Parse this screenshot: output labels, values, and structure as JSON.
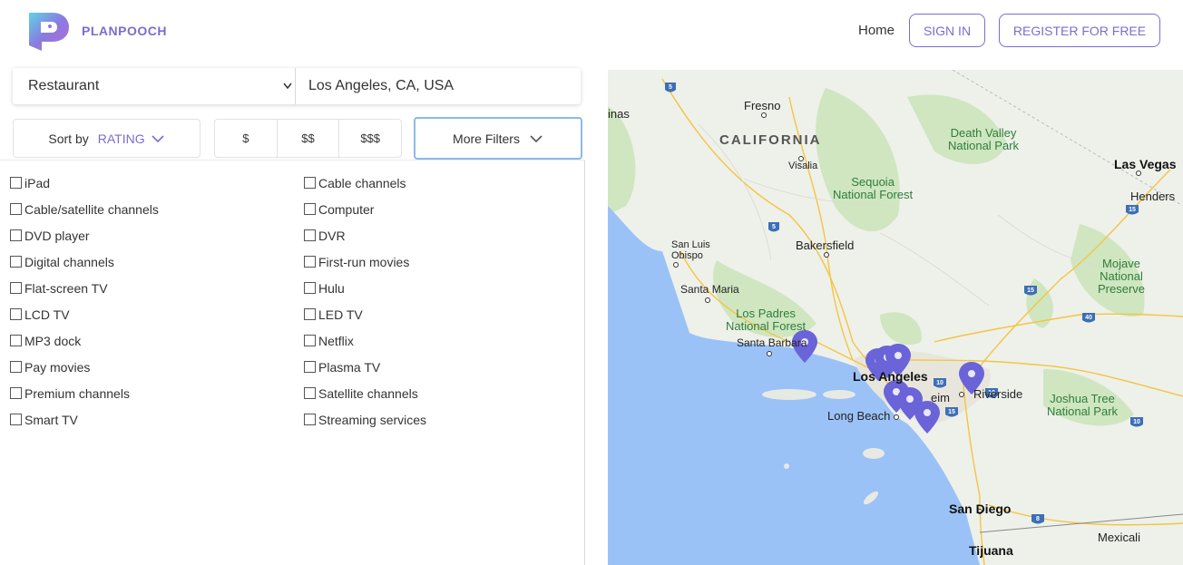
{
  "header": {
    "brand": "PLANPOOCH",
    "nav_home": "Home",
    "sign_in": "SIGN IN",
    "register": "REGISTER FOR FREE"
  },
  "search": {
    "category": "Restaurant",
    "location": "Los Angeles, CA, USA"
  },
  "filters_bar": {
    "sort_label": "Sort by",
    "sort_value": "RATING",
    "price_options": [
      "$",
      "$$",
      "$$$"
    ],
    "more_filters": "More Filters"
  },
  "amenities": {
    "left": [
      "iPad",
      "Cable/satellite channels",
      "DVD player",
      "Digital channels",
      "Flat-screen TV",
      "LCD TV",
      "MP3 dock",
      "Pay movies",
      "Premium channels",
      "Smart TV"
    ],
    "right": [
      "Cable channels",
      "Computer",
      "DVR",
      "First-run movies",
      "Hulu",
      "LED TV",
      "Netflix",
      "Plasma TV",
      "Satellite channels",
      "Streaming services"
    ]
  },
  "map": {
    "labels": {
      "fresno": "Fresno",
      "california": "CALIFORNIA",
      "visalia": "Visalia",
      "sequoia": "Sequoia\nNational Forest",
      "death_valley": "Death Valley\nNational Park",
      "las_vegas": "Las Vegas",
      "henderson": "Henders",
      "bakersfield": "Bakersfield",
      "san_luis_obispo": "San Luis\nObispo",
      "santa_maria": "Santa Maria",
      "los_padres": "Los Padres\nNational Forest",
      "santa_barbara": "Santa Barbara",
      "los_angeles": "Los Angeles",
      "riverside": "Riverside",
      "anaheim": "eim",
      "long_beach": "Long Beach",
      "mojave": "Mojave\nNational\nPreserve",
      "joshua_tree": "Joshua Tree\nNational Park",
      "san_diego": "San Diego",
      "tijuana": "Tijuana",
      "mexicali": "Mexicali",
      "inas": "inas"
    },
    "highways": [
      "5",
      "5",
      "15",
      "15",
      "40",
      "10",
      "10",
      "15",
      "8",
      "10"
    ]
  }
}
